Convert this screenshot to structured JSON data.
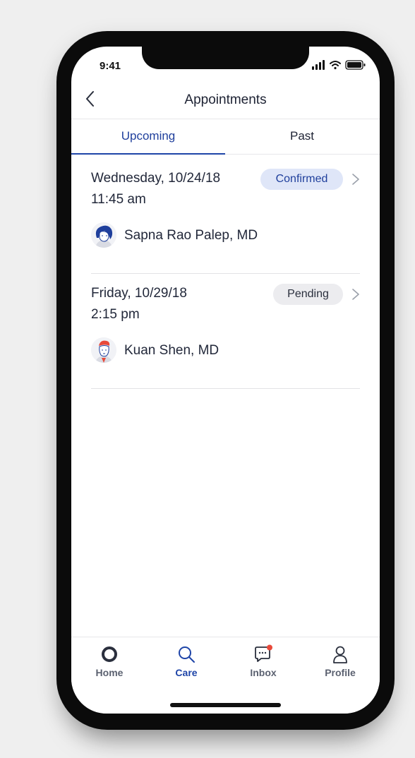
{
  "status_bar": {
    "time": "9:41"
  },
  "header": {
    "title": "Appointments"
  },
  "tabs": [
    {
      "label": "Upcoming",
      "active": true
    },
    {
      "label": "Past",
      "active": false
    }
  ],
  "appointments": [
    {
      "date": "Wednesday, 10/24/18",
      "time": "11:45 am",
      "status": "Confirmed",
      "doctor": "Sapna Rao Palep, MD"
    },
    {
      "date": "Friday, 10/29/18",
      "time": "2:15 pm",
      "status": "Pending",
      "doctor": "Kuan Shen, MD"
    }
  ],
  "tabbar": [
    {
      "label": "Home",
      "icon": "home-icon"
    },
    {
      "label": "Care",
      "icon": "search-icon",
      "active": true
    },
    {
      "label": "Inbox",
      "icon": "chat-icon",
      "badge": true
    },
    {
      "label": "Profile",
      "icon": "person-icon"
    }
  ],
  "colors": {
    "accent": "#1f45a8",
    "confirmed_bg": "#dfe6f8",
    "pending_bg": "#ececef",
    "notification": "#e8493a"
  }
}
